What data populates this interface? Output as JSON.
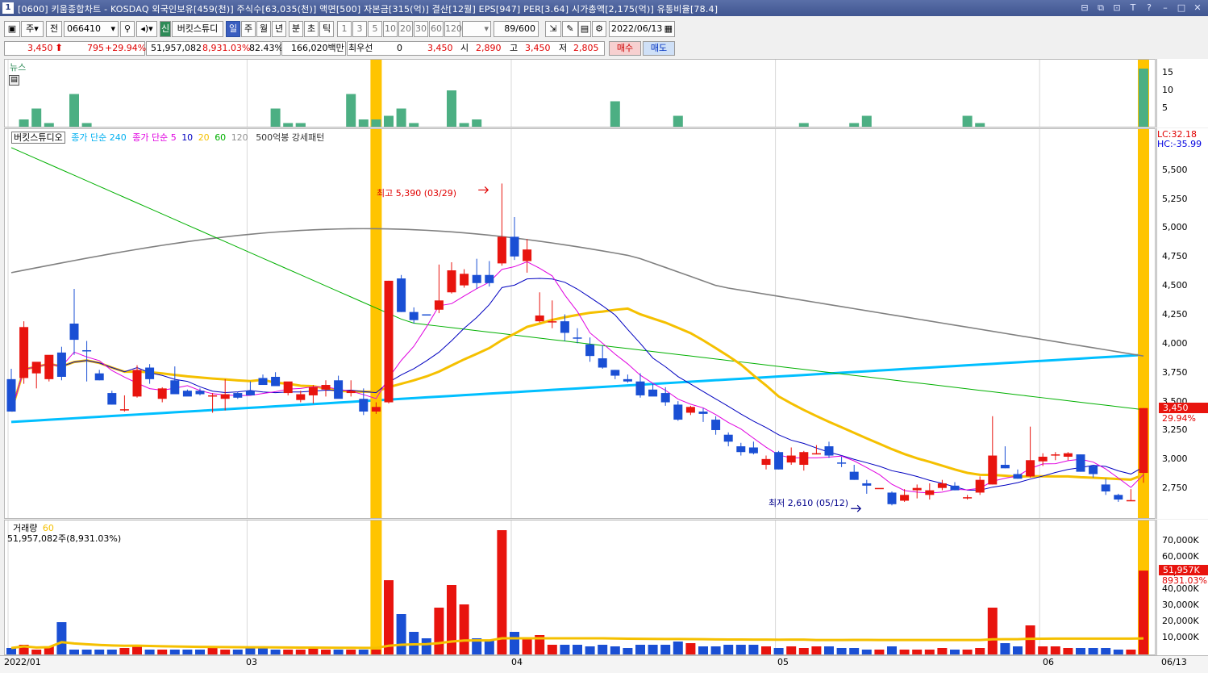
{
  "window": {
    "number": "1",
    "title": "[0600] 키움종합차트 - KOSDAQ 외국인보유[459(천)] 주식수[63,035(천)] 액면[500] 자본금[315(억)] 결산[12월] EPS[947] PER[3.64] 시가총액[2,175(억)] 유통비율[78.4]",
    "controls": [
      "⊟",
      "⧉",
      "⊡",
      "T",
      "?",
      "–",
      "□",
      "✕"
    ]
  },
  "toolbar": {
    "market": "주",
    "all": "전",
    "code": "066410",
    "stock_name": "버킷스튜디",
    "periods": [
      "일",
      "주",
      "월",
      "년",
      "분",
      "초",
      "틱"
    ],
    "intervals": [
      "1",
      "3",
      "5",
      "10",
      "20",
      "30",
      "60",
      "120"
    ],
    "count": "89/600",
    "date": "2022/06/13"
  },
  "quote": {
    "price": "3,450",
    "change": "795",
    "change_pct": "+29.94%",
    "volume": "51,957,082",
    "volume_pct": "8,931.03%",
    "ratio": "82.43%",
    "amount": "166,020백만",
    "pref_label": "최우선",
    "pref_value": "0",
    "ask": "3,450",
    "open_label": "시",
    "open": "2,890",
    "high_label": "고",
    "high": "3,450",
    "low_label": "저",
    "low": "2,805",
    "buy": "매수",
    "sell": "매도"
  },
  "news_panel": {
    "label": "뉴스",
    "ticks": [
      "15",
      "10",
      "5"
    ]
  },
  "price_panel": {
    "legend": {
      "name": "버킷스튜디오",
      "ma240": "종가 단순 240",
      "ma_label": "종가 단순",
      "ma5": "5",
      "ma10": "10",
      "ma20": "20",
      "ma60": "60",
      "ma120": "120",
      "pattern": "500억봉 강세패턴"
    },
    "high_annot": "최고 5,390 (03/29)",
    "low_annot": "최저 2,610 (05/12)",
    "lc": "LC:32.18",
    "hc": "HC:-35.99",
    "last_price_tag": "3,450",
    "last_pct_tag": "29.94%",
    "ticks": [
      "5,500",
      "5,250",
      "5,000",
      "4,750",
      "4,500",
      "4,250",
      "4,000",
      "3,750",
      "3,500",
      "3,250",
      "3,000",
      "2,750"
    ]
  },
  "volume_panel": {
    "label": "거래량",
    "ma": "60",
    "summary": "51,957,082주(8,931.03%)",
    "last_tag": "51,957K",
    "last_pct": "8931.03%",
    "ticks": [
      "70,000K",
      "60,000K",
      "50,000K",
      "40,000K",
      "30,000K",
      "20,000K",
      "10,000K"
    ]
  },
  "dates": [
    "2022/01",
    "03",
    "04",
    "05",
    "06",
    "06/13"
  ],
  "colors": {
    "up": "#e8140e",
    "down": "#1a4fd4",
    "ma5": "#e000e0",
    "ma10": "#0000c0",
    "ma20": "#f5c000",
    "ma60": "#00b000",
    "ma120": "#808080",
    "ma240": "#00bfff",
    "fill": "#9ccdf8",
    "news": "#4caf83",
    "highlight": "#ffc400"
  },
  "chart_data": {
    "type": "candlestick",
    "candles": [
      {
        "o": 3700,
        "h": 3790,
        "l": 3440,
        "c": 3420
      },
      {
        "o": 3710,
        "h": 4200,
        "l": 3660,
        "c": 4150
      },
      {
        "o": 3750,
        "h": 3800,
        "l": 3620,
        "c": 3850
      },
      {
        "o": 3700,
        "h": 3830,
        "l": 3680,
        "c": 3910
      },
      {
        "o": 3930,
        "h": 3980,
        "l": 3690,
        "c": 3720
      },
      {
        "o": 4180,
        "h": 4480,
        "l": 3910,
        "c": 4040
      },
      {
        "o": 3950,
        "h": 4030,
        "l": 3680,
        "c": 3940
      },
      {
        "o": 3750,
        "h": 3780,
        "l": 3690,
        "c": 3690
      },
      {
        "o": 3580,
        "h": 3600,
        "l": 3480,
        "c": 3480
      },
      {
        "o": 3440,
        "h": 3560,
        "l": 3420,
        "c": 3440
      },
      {
        "o": 3550,
        "h": 3820,
        "l": 3540,
        "c": 3780
      },
      {
        "o": 3800,
        "h": 3830,
        "l": 3660,
        "c": 3700
      },
      {
        "o": 3530,
        "h": 3630,
        "l": 3500,
        "c": 3620
      },
      {
        "o": 3690,
        "h": 3810,
        "l": 3660,
        "c": 3570
      },
      {
        "o": 3600,
        "h": 3610,
        "l": 3570,
        "c": 3550
      },
      {
        "o": 3600,
        "h": 3620,
        "l": 3560,
        "c": 3570
      },
      {
        "o": 3560,
        "h": 3580,
        "l": 3410,
        "c": 3560
      },
      {
        "o": 3530,
        "h": 3700,
        "l": 3430,
        "c": 3570
      },
      {
        "o": 3580,
        "h": 3590,
        "l": 3530,
        "c": 3540
      },
      {
        "o": 3600,
        "h": 3680,
        "l": 3570,
        "c": 3560
      },
      {
        "o": 3710,
        "h": 3740,
        "l": 3650,
        "c": 3650
      },
      {
        "o": 3720,
        "h": 3760,
        "l": 3690,
        "c": 3640
      },
      {
        "o": 3580,
        "h": 3650,
        "l": 3560,
        "c": 3680
      },
      {
        "o": 3520,
        "h": 3600,
        "l": 3500,
        "c": 3570
      },
      {
        "o": 3560,
        "h": 3650,
        "l": 3490,
        "c": 3630
      },
      {
        "o": 3610,
        "h": 3690,
        "l": 3550,
        "c": 3650
      },
      {
        "o": 3690,
        "h": 3730,
        "l": 3610,
        "c": 3530
      },
      {
        "o": 3580,
        "h": 3690,
        "l": 3550,
        "c": 3600
      },
      {
        "o": 3530,
        "h": 3620,
        "l": 3390,
        "c": 3420
      },
      {
        "o": 3420,
        "h": 3500,
        "l": 3400,
        "c": 3460
      },
      {
        "o": 3500,
        "h": 4550,
        "l": 3490,
        "c": 4550
      },
      {
        "o": 4570,
        "h": 4600,
        "l": 4280,
        "c": 4280
      },
      {
        "o": 4280,
        "h": 4320,
        "l": 4180,
        "c": 4210
      },
      {
        "o": 4260,
        "h": 4260,
        "l": 4260,
        "c": 4250
      },
      {
        "o": 4300,
        "h": 4690,
        "l": 4270,
        "c": 4380
      },
      {
        "o": 4450,
        "h": 4710,
        "l": 4440,
        "c": 4640
      },
      {
        "o": 4510,
        "h": 4650,
        "l": 4490,
        "c": 4610
      },
      {
        "o": 4600,
        "h": 4740,
        "l": 4480,
        "c": 4530
      },
      {
        "o": 4600,
        "h": 4720,
        "l": 4500,
        "c": 4530
      },
      {
        "o": 4700,
        "h": 5390,
        "l": 4680,
        "c": 4930
      },
      {
        "o": 4930,
        "h": 5100,
        "l": 4730,
        "c": 4760
      },
      {
        "o": 4720,
        "h": 4910,
        "l": 4620,
        "c": 4820
      },
      {
        "o": 4200,
        "h": 4450,
        "l": 4190,
        "c": 4250
      },
      {
        "o": 4200,
        "h": 4380,
        "l": 4140,
        "c": 4200
      },
      {
        "o": 4200,
        "h": 4260,
        "l": 4030,
        "c": 4100
      },
      {
        "o": 4060,
        "h": 4140,
        "l": 4010,
        "c": 4050
      },
      {
        "o": 4000,
        "h": 4060,
        "l": 3850,
        "c": 3900
      },
      {
        "o": 3880,
        "h": 3990,
        "l": 3790,
        "c": 3800
      },
      {
        "o": 3780,
        "h": 3780,
        "l": 3700,
        "c": 3730
      },
      {
        "o": 3700,
        "h": 3740,
        "l": 3670,
        "c": 3680
      },
      {
        "o": 3680,
        "h": 3750,
        "l": 3540,
        "c": 3560
      },
      {
        "o": 3610,
        "h": 3660,
        "l": 3560,
        "c": 3550
      },
      {
        "o": 3580,
        "h": 3630,
        "l": 3470,
        "c": 3500
      },
      {
        "o": 3480,
        "h": 3510,
        "l": 3340,
        "c": 3350
      },
      {
        "o": 3410,
        "h": 3470,
        "l": 3390,
        "c": 3460
      },
      {
        "o": 3420,
        "h": 3450,
        "l": 3330,
        "c": 3400
      },
      {
        "o": 3350,
        "h": 3380,
        "l": 3220,
        "c": 3260
      },
      {
        "o": 3220,
        "h": 3240,
        "l": 3120,
        "c": 3160
      },
      {
        "o": 3120,
        "h": 3150,
        "l": 3040,
        "c": 3070
      },
      {
        "o": 3110,
        "h": 3160,
        "l": 3050,
        "c": 3060
      },
      {
        "o": 2960,
        "h": 3040,
        "l": 2920,
        "c": 3010
      },
      {
        "o": 3070,
        "h": 3080,
        "l": 2920,
        "c": 2920
      },
      {
        "o": 2980,
        "h": 3110,
        "l": 2960,
        "c": 3040
      },
      {
        "o": 2960,
        "h": 3080,
        "l": 2910,
        "c": 3070
      },
      {
        "o": 3050,
        "h": 3130,
        "l": 3050,
        "c": 3060
      },
      {
        "o": 3120,
        "h": 3160,
        "l": 3020,
        "c": 3040
      },
      {
        "o": 2980,
        "h": 3030,
        "l": 2940,
        "c": 2970
      },
      {
        "o": 2900,
        "h": 2960,
        "l": 2830,
        "c": 2830
      },
      {
        "o": 2800,
        "h": 2830,
        "l": 2710,
        "c": 2780
      },
      {
        "o": 2760,
        "h": 2760,
        "l": 2760,
        "c": 2760
      },
      {
        "o": 2720,
        "h": 2730,
        "l": 2610,
        "c": 2620
      },
      {
        "o": 2650,
        "h": 2750,
        "l": 2640,
        "c": 2700
      },
      {
        "o": 2740,
        "h": 2790,
        "l": 2670,
        "c": 2760
      },
      {
        "o": 2700,
        "h": 2800,
        "l": 2660,
        "c": 2740
      },
      {
        "o": 2760,
        "h": 2830,
        "l": 2740,
        "c": 2800
      },
      {
        "o": 2780,
        "h": 2810,
        "l": 2740,
        "c": 2740
      },
      {
        "o": 2680,
        "h": 2700,
        "l": 2660,
        "c": 2680
      },
      {
        "o": 2720,
        "h": 2860,
        "l": 2700,
        "c": 2830
      },
      {
        "o": 2790,
        "h": 3380,
        "l": 2790,
        "c": 3040
      },
      {
        "o": 2960,
        "h": 3120,
        "l": 2930,
        "c": 2930
      },
      {
        "o": 2880,
        "h": 2920,
        "l": 2840,
        "c": 2840
      },
      {
        "o": 2860,
        "h": 3290,
        "l": 2850,
        "c": 3000
      },
      {
        "o": 2990,
        "h": 3060,
        "l": 2950,
        "c": 3030
      },
      {
        "o": 3050,
        "h": 3070,
        "l": 3000,
        "c": 3050
      },
      {
        "o": 3030,
        "h": 3070,
        "l": 3000,
        "c": 3060
      },
      {
        "o": 3050,
        "h": 3050,
        "l": 2900,
        "c": 2900
      },
      {
        "o": 2950,
        "h": 2960,
        "l": 2850,
        "c": 2880
      },
      {
        "o": 2790,
        "h": 2840,
        "l": 2700,
        "c": 2730
      },
      {
        "o": 2700,
        "h": 2710,
        "l": 2640,
        "c": 2660
      },
      {
        "o": 2650,
        "h": 2750,
        "l": 2650,
        "c": 2655
      },
      {
        "o": 2890,
        "h": 3450,
        "l": 2805,
        "c": 3450
      }
    ],
    "volume_k": [
      4000,
      6000,
      3000,
      5000,
      20000,
      3000,
      3000,
      3000,
      3000,
      4000,
      6000,
      3000,
      3000,
      3000,
      3000,
      3000,
      4000,
      3000,
      3000,
      4000,
      4000,
      3000,
      3000,
      3000,
      4000,
      3000,
      3000,
      3000,
      3000,
      3000,
      46000,
      25000,
      14000,
      10000,
      29000,
      43000,
      31000,
      10000,
      9000,
      77000,
      14000,
      10000,
      12000,
      6000,
      6000,
      6000,
      5000,
      6000,
      5000,
      4000,
      6000,
      6000,
      6000,
      8000,
      7000,
      5000,
      5000,
      6000,
      6000,
      6000,
      5000,
      4000,
      5000,
      4000,
      5000,
      5000,
      4000,
      4000,
      3000,
      3000,
      5000,
      3000,
      3000,
      3000,
      4000,
      3000,
      3000,
      4000,
      29000,
      7000,
      5000,
      18000,
      5000,
      5000,
      4000,
      4000,
      4000,
      4000,
      3000,
      3000,
      51957
    ],
    "news": [
      0,
      2,
      5,
      1,
      0,
      9,
      1,
      1,
      0,
      0,
      0,
      0,
      0,
      0,
      0,
      0,
      0,
      0,
      0,
      0,
      0,
      0,
      0,
      5,
      1,
      1,
      1,
      0,
      0,
      0,
      9,
      2,
      2,
      3,
      5,
      0,
      1,
      0,
      0,
      10,
      1,
      2,
      0,
      0,
      0,
      0,
      0,
      0,
      0,
      0,
      0,
      0,
      0,
      7,
      0,
      0,
      0,
      0,
      0,
      3,
      0,
      0,
      0,
      0,
      0,
      0,
      0,
      0,
      0,
      0,
      1,
      0,
      0,
      0,
      1,
      3,
      0,
      0,
      0,
      0,
      0,
      0,
      0,
      0,
      3,
      1,
      0,
      0,
      0,
      0,
      0,
      0,
      0,
      0,
      0,
      0,
      0,
      0,
      0,
      0,
      16
    ]
  }
}
